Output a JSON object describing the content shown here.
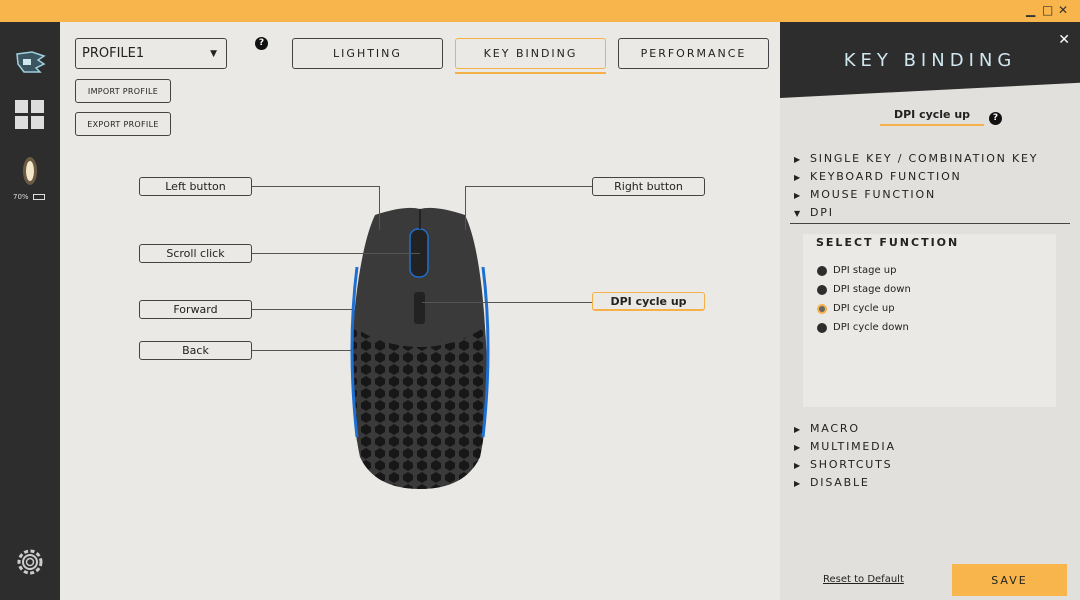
{
  "window": {
    "minimize": "▁",
    "maximize": "□",
    "close": "✕"
  },
  "sidebar": {
    "battery": "70%"
  },
  "profile": {
    "selected": "PROFILE1",
    "import": "IMPORT PROFILE",
    "export": "EXPORT PROFILE",
    "help": "?"
  },
  "tabs": [
    {
      "label": "LIGHTING"
    },
    {
      "label": "KEY BINDING",
      "active": true
    },
    {
      "label": "PERFORMANCE"
    }
  ],
  "mouse_buttons": {
    "left": "Left button",
    "right": "Right button",
    "scroll": "Scroll click",
    "forward": "Forward",
    "back": "Back",
    "dpi": "DPI cycle up"
  },
  "panel": {
    "title": "KEY BINDING",
    "close": "✕",
    "current": "DPI cycle up",
    "help": "?",
    "sections_top": [
      "SINGLE KEY / COMBINATION KEY",
      "KEYBOARD FUNCTION",
      "MOUSE FUNCTION"
    ],
    "open_section": "DPI",
    "select_title": "SELECT FUNCTION",
    "functions": [
      "DPI stage up",
      "DPI stage down",
      "DPI cycle up",
      "DPI cycle down"
    ],
    "selected_function": "DPI cycle up",
    "sections_bottom": [
      "MACRO",
      "MULTIMEDIA",
      "SHORTCUTS",
      "DISABLE"
    ],
    "reset": "Reset to Default",
    "save": "SAVE"
  },
  "colors": {
    "accent": "#f8b54b",
    "dark": "#2d2d2d",
    "led": "#1e6fd0"
  }
}
